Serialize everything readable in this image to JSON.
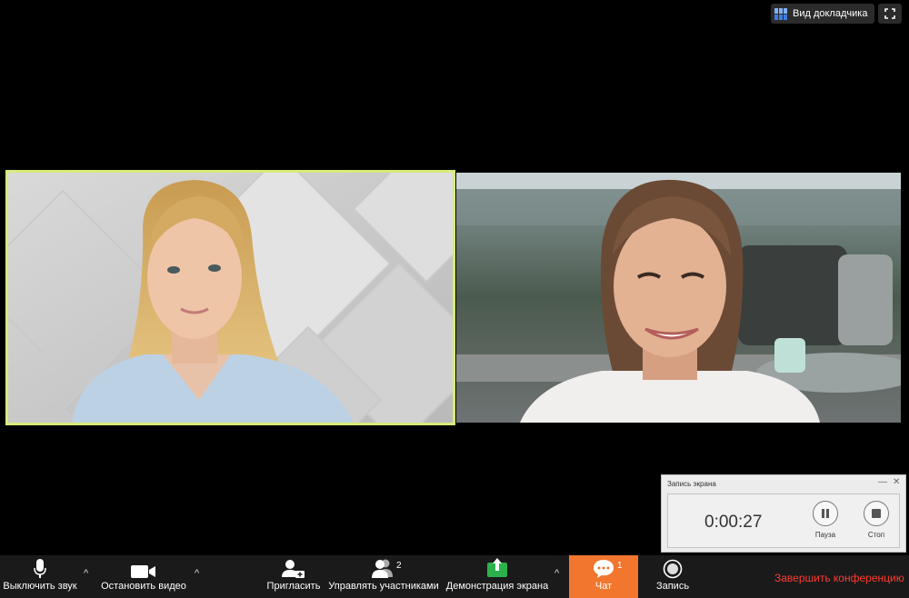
{
  "top_controls": {
    "speaker_view_label": "Вид докладчика",
    "grid_icon": "grid-icon",
    "fullscreen_icon": "fullscreen-icon"
  },
  "participants": [
    {
      "active_speaker": true,
      "border_color": "#d8ea7a"
    },
    {
      "active_speaker": false
    }
  ],
  "recording": {
    "title": "Запись экрана",
    "time": "0:00:27",
    "pause_label": "Пауза",
    "stop_label": "Стоп"
  },
  "toolbar": {
    "mute_label": "Выключить звук",
    "video_label": "Остановить видео",
    "invite_label": "Пригласить",
    "participants_label": "Управлять участниками",
    "participants_count": "2",
    "share_label": "Демонстрация экрана",
    "chat_label": "Чат",
    "chat_count": "1",
    "record_label": "Запись",
    "end_label": "Завершить конференцию",
    "caret": "^"
  },
  "colors": {
    "chat_active": "#f2762e",
    "end_meeting": "#ff3b30",
    "share_icon": "#2bb24c",
    "active_speaker_border": "#d8ea7a"
  }
}
